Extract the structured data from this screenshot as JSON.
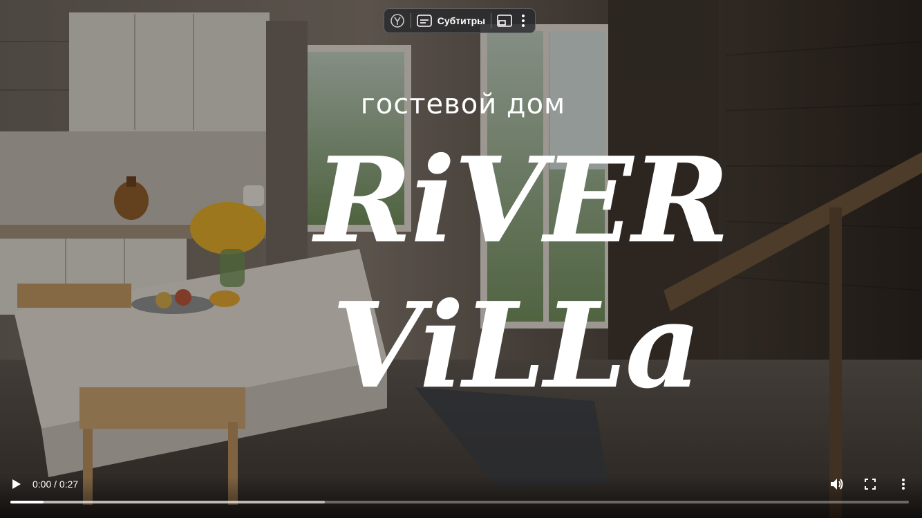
{
  "overlay": {
    "subtitle": "гостевой дом",
    "logo_line1": "RiVER",
    "logo_line2": "ViLLa"
  },
  "toolbar": {
    "subtitles_label": "Субтитры"
  },
  "controls": {
    "time": "0:00 / 0:27",
    "progress_played_fraction": 0.037,
    "progress_buffered_fraction": 0.35
  },
  "icons": {
    "browser_logo": "yandex-logo-icon",
    "subtitles": "subtitles-icon",
    "pip": "picture-in-picture-icon",
    "menu": "more-vertical-icon",
    "play": "play-icon",
    "volume": "volume-icon",
    "fullscreen": "fullscreen-icon",
    "options": "more-vertical-icon"
  }
}
